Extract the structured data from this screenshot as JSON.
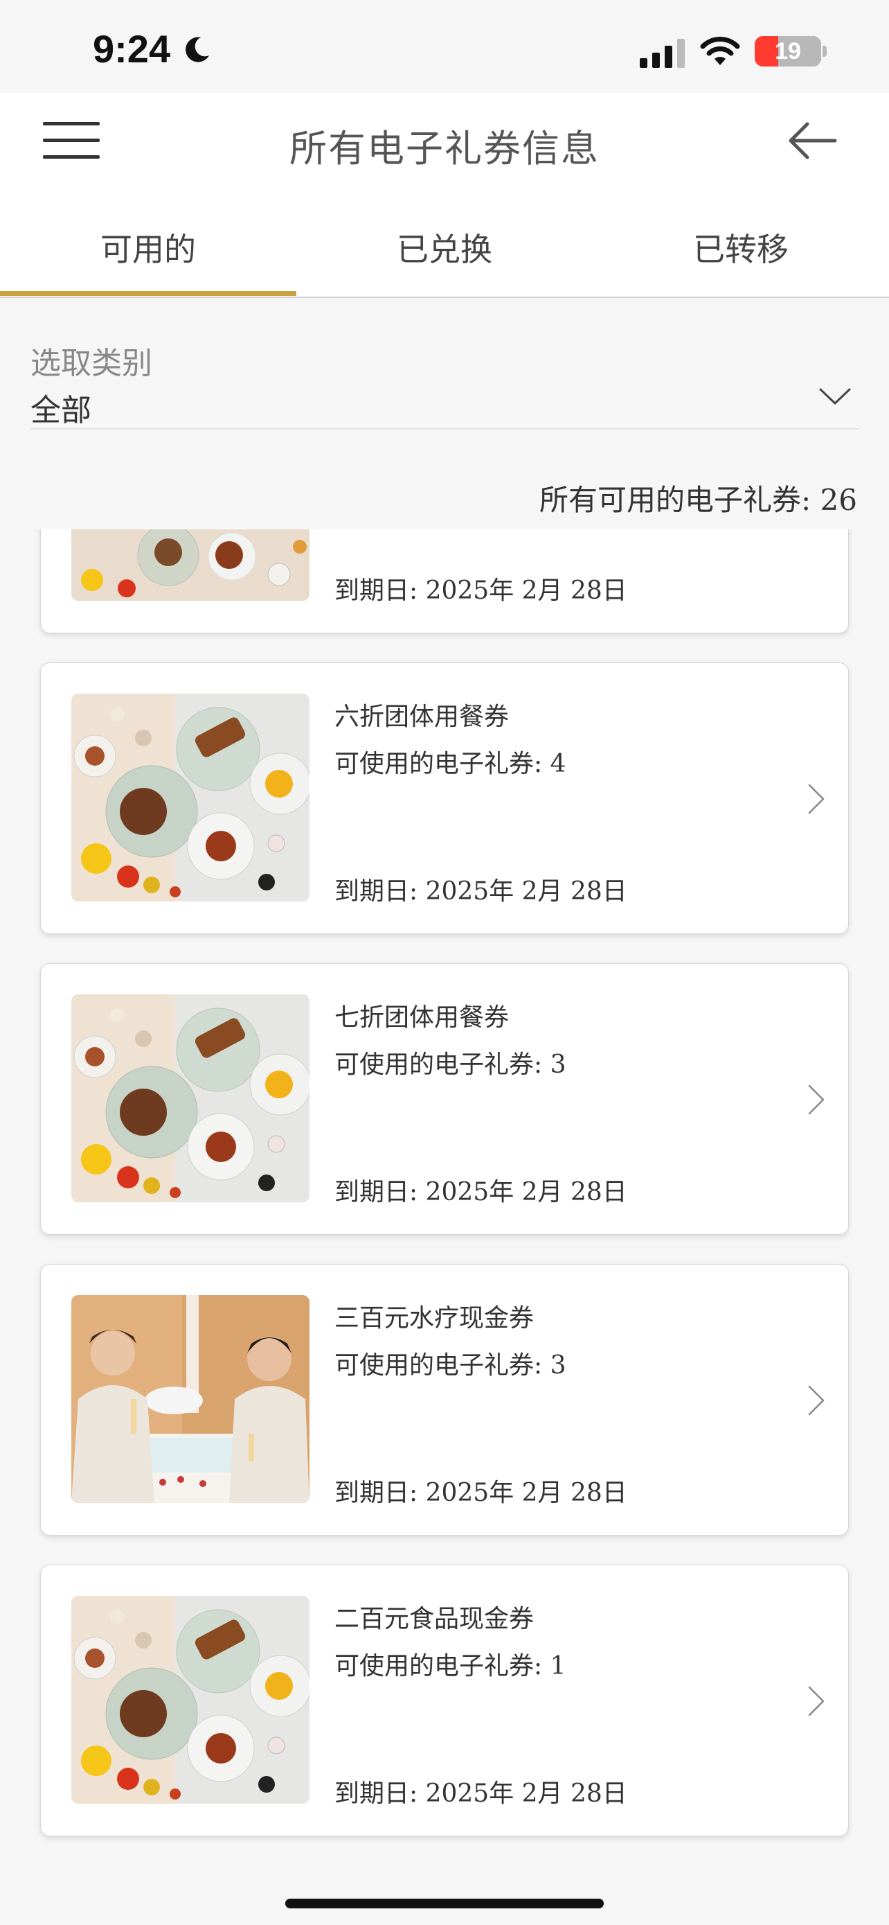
{
  "status_bar": {
    "time": "9:24",
    "battery_level": "19",
    "icons": [
      "moon-icon",
      "signal-icon",
      "wifi-icon",
      "battery-charging-icon"
    ]
  },
  "header": {
    "title": "所有电子礼券信息",
    "menu_icon": "hamburger-menu-icon",
    "back_icon": "back-arrow-icon"
  },
  "tabs": [
    {
      "label": "可用的",
      "active": true
    },
    {
      "label": "已兑换",
      "active": false
    },
    {
      "label": "已转移",
      "active": false
    }
  ],
  "filter": {
    "label": "选取类别",
    "value": "全部"
  },
  "count_text": "所有可用的电子礼券: 26",
  "accent_color": "#c9a13f",
  "vouchers": [
    {
      "name": "",
      "available": "",
      "expiry": "到期日:  2025年 2月 28日",
      "image": "dining"
    },
    {
      "name": "六折团体用餐券",
      "available": "可使用的电子礼券: 4",
      "expiry": "到期日:  2025年 2月 28日",
      "image": "dining"
    },
    {
      "name": "七折团体用餐券",
      "available": "可使用的电子礼券: 3",
      "expiry": "到期日:  2025年 2月 28日",
      "image": "dining"
    },
    {
      "name": "三百元水疗现金券",
      "available": "可使用的电子礼券: 3",
      "expiry": "到期日:  2025年 2月 28日",
      "image": "spa"
    },
    {
      "name": "二百元食品现金券",
      "available": "可使用的电子礼券: 1",
      "expiry": "到期日:  2025年 2月 28日",
      "image": "dining"
    }
  ]
}
